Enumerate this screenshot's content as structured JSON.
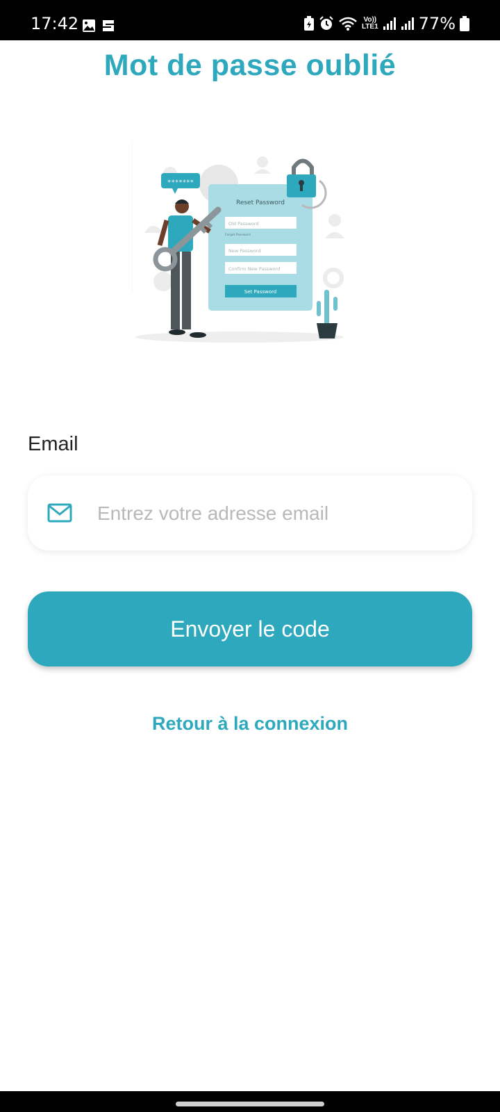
{
  "status_bar": {
    "time": "17:42",
    "battery": "77%",
    "network_label_top": "Vo))",
    "network_label_bottom": "LTE1"
  },
  "page": {
    "title": "Mot de passe oublié"
  },
  "illustration": {
    "panel_title": "Reset Password",
    "field_1": "Old Password",
    "forgot_hint": "Forgot Password",
    "field_2": "New Password",
    "field_3": "Confirm New Password",
    "button": "Set Password",
    "bubble": "*******"
  },
  "form": {
    "email_label": "Email",
    "email_placeholder": "Entrez votre adresse email",
    "email_value": "",
    "submit_label": "Envoyer le code",
    "back_label": "Retour à la connexion"
  },
  "colors": {
    "accent": "#2ea8bd",
    "text": "#222222",
    "placeholder": "#b8b8b8"
  }
}
